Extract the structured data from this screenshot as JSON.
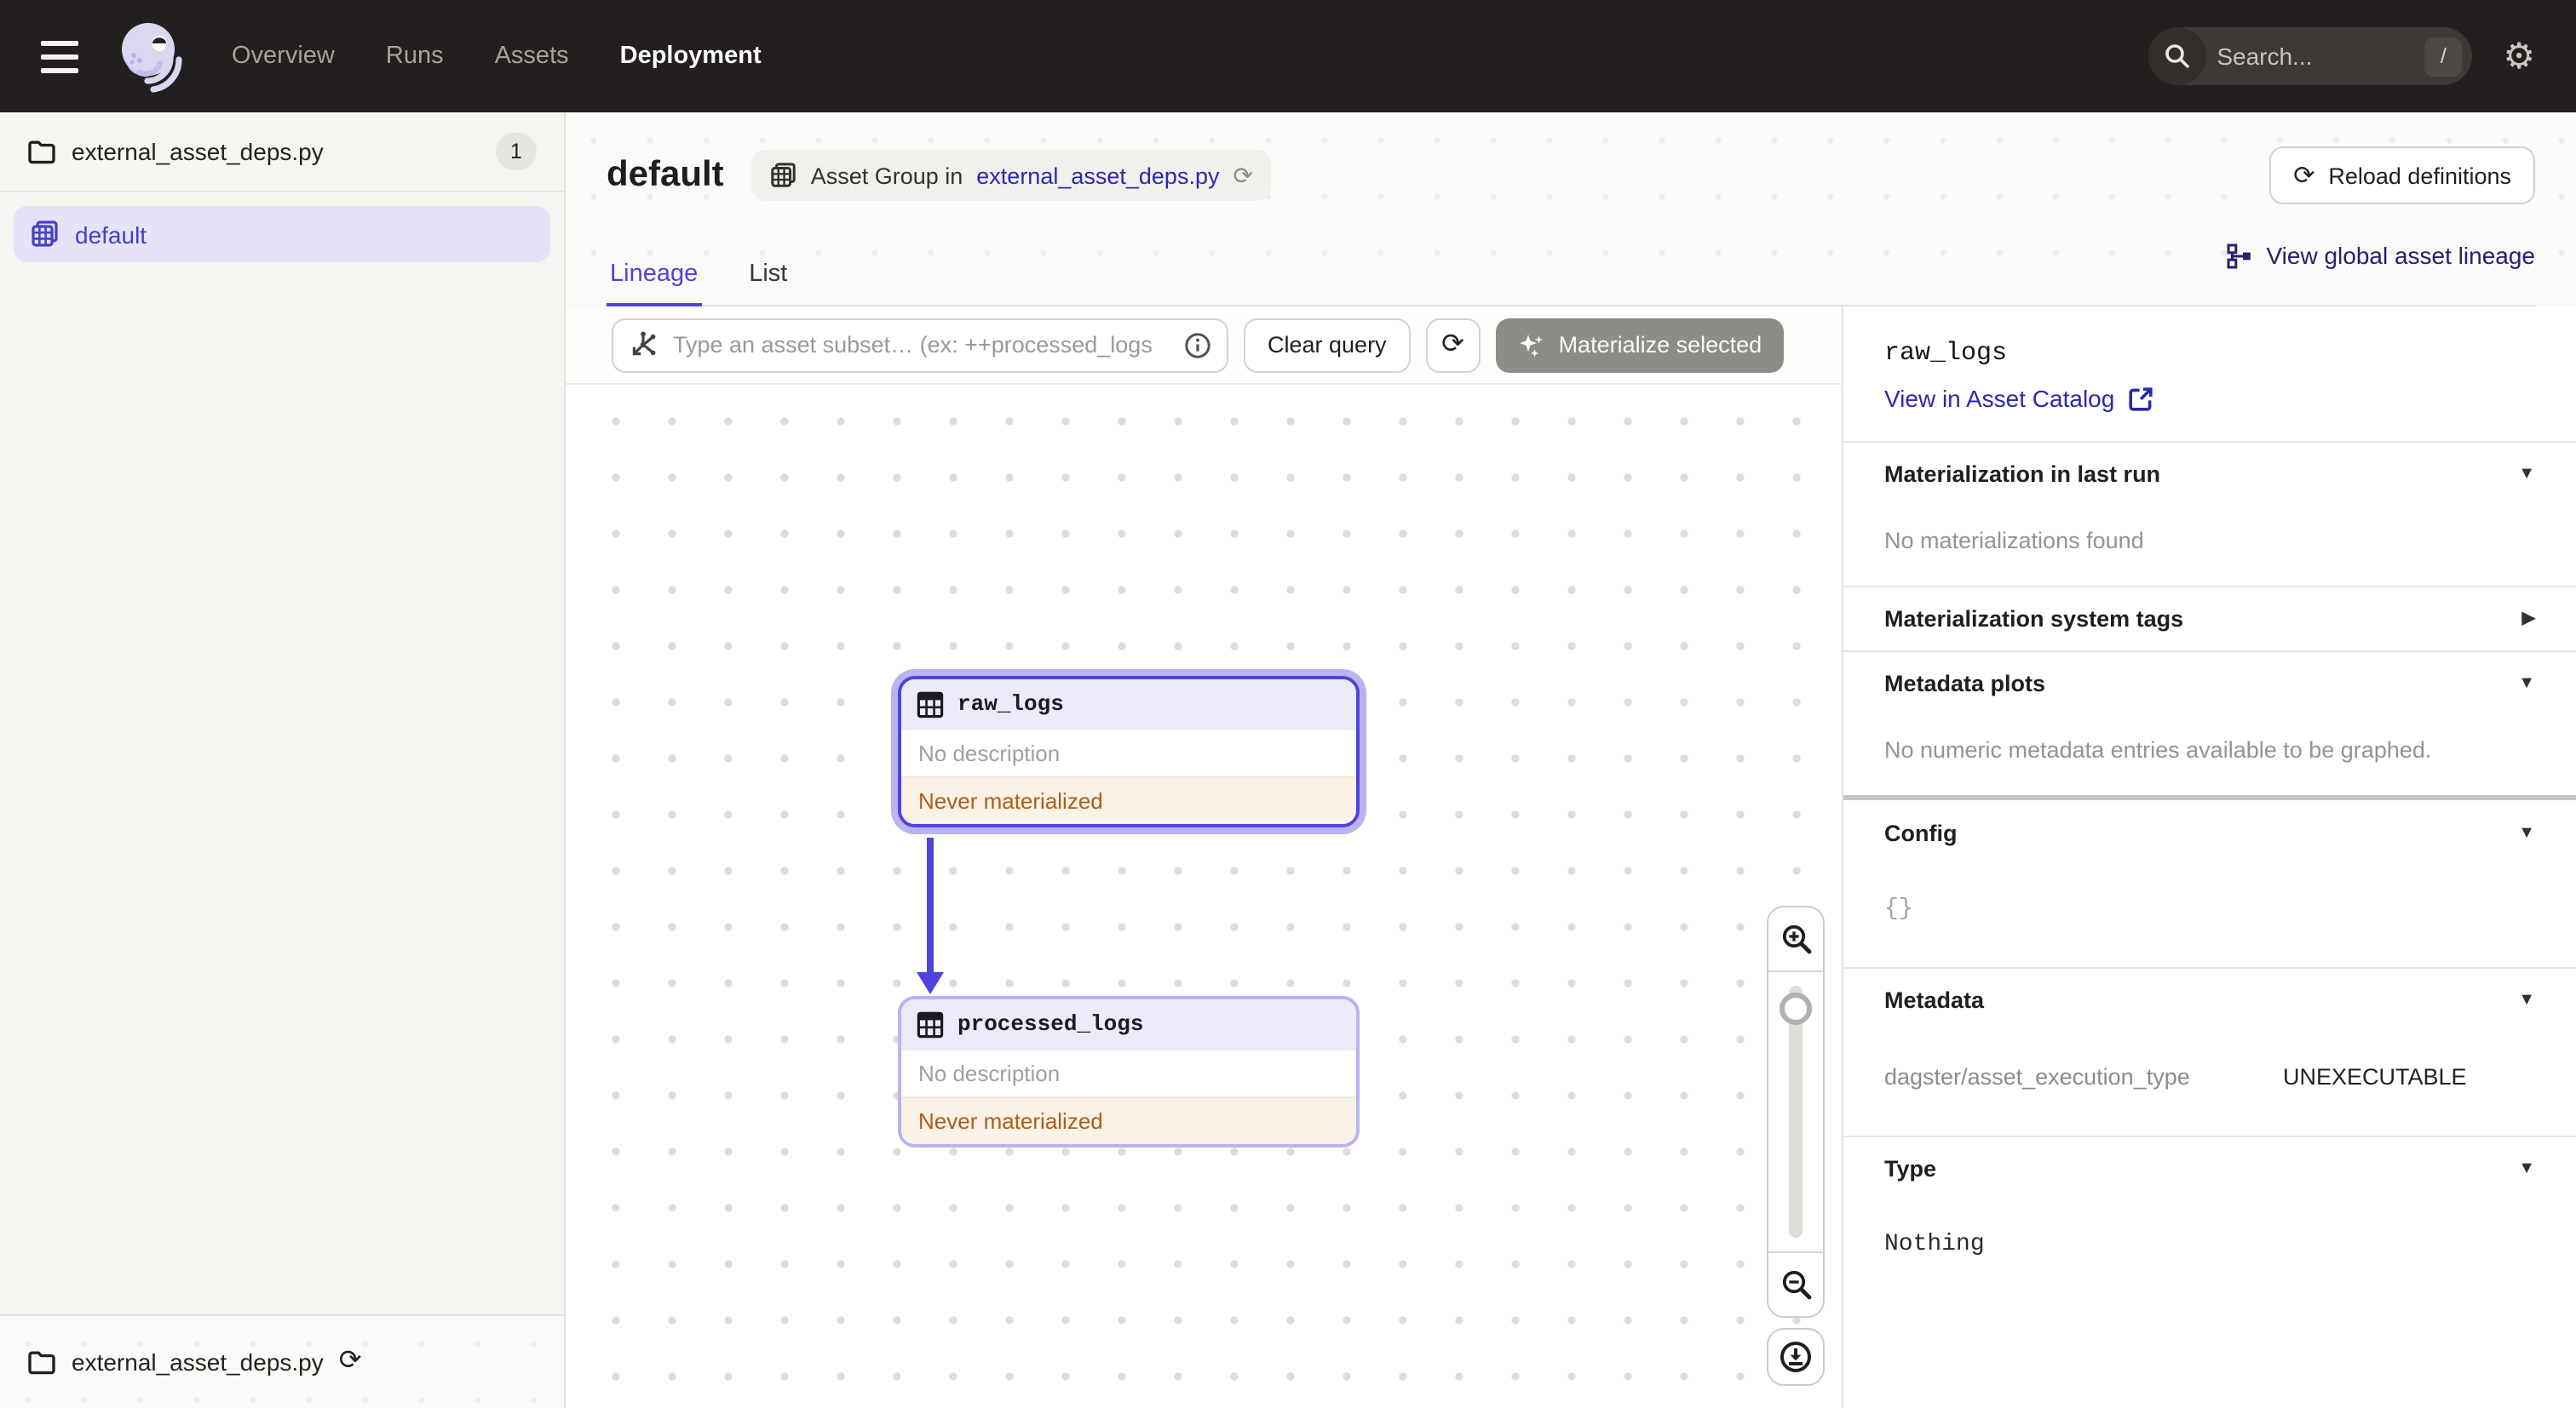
{
  "icons": {
    "caret_down": "▼",
    "caret_right": "▶",
    "gear": "⚙",
    "refresh": "⟳"
  },
  "navbar": {
    "items": [
      {
        "label": "Overview",
        "active": false
      },
      {
        "label": "Runs",
        "active": false
      },
      {
        "label": "Assets",
        "active": false
      },
      {
        "label": "Deployment",
        "active": true
      }
    ],
    "search_placeholder": "Search...",
    "search_shortcut": "/"
  },
  "sidebar": {
    "repo": {
      "name": "external_asset_deps.py",
      "count": "1"
    },
    "groups": [
      {
        "label": "default",
        "selected": true
      }
    ],
    "footer": {
      "repo_name": "external_asset_deps.py"
    }
  },
  "header": {
    "title": "default",
    "breadcrumb": {
      "prefix": "Asset Group in",
      "link": "external_asset_deps.py"
    },
    "reload_button": "Reload definitions",
    "tabs": [
      {
        "label": "Lineage",
        "active": true
      },
      {
        "label": "List",
        "active": false
      }
    ],
    "global_lineage_link": "View global asset lineage"
  },
  "toolbar": {
    "query_placeholder": "Type an asset subset… (ex: ++processed_logs",
    "clear_button": "Clear query",
    "materialize_button": "Materialize selected"
  },
  "graph": {
    "nodes": [
      {
        "name": "raw_logs",
        "description": "No description",
        "status": "Never materialized",
        "selected": true
      },
      {
        "name": "processed_logs",
        "description": "No description",
        "status": "Never materialized",
        "selected": false
      }
    ],
    "edge": {
      "from": "raw_logs",
      "to": "processed_logs"
    }
  },
  "panel": {
    "title": "raw_logs",
    "catalog_link": "View in Asset Catalog",
    "sections": [
      {
        "title": "Materialization in last run",
        "content": "No materializations found"
      },
      {
        "title": "Materialization system tags"
      },
      {
        "title": "Metadata plots",
        "content": "No numeric metadata entries available to be graphed."
      },
      {
        "title": "Config",
        "content": "{}"
      },
      {
        "title": "Metadata",
        "row": {
          "key": "dagster/asset_execution_type",
          "value": "UNEXECUTABLE"
        }
      },
      {
        "title": "Type",
        "content": "Nothing"
      }
    ]
  },
  "colors": {
    "accent": "#4F43DD",
    "selection_halo": "#B9B4F0",
    "link": "#2B28AE",
    "navy_link": "#232271",
    "warning_text": "#AD5F12",
    "warning_bg": "#FAF1E7",
    "navbar_bg": "#231F1E"
  }
}
